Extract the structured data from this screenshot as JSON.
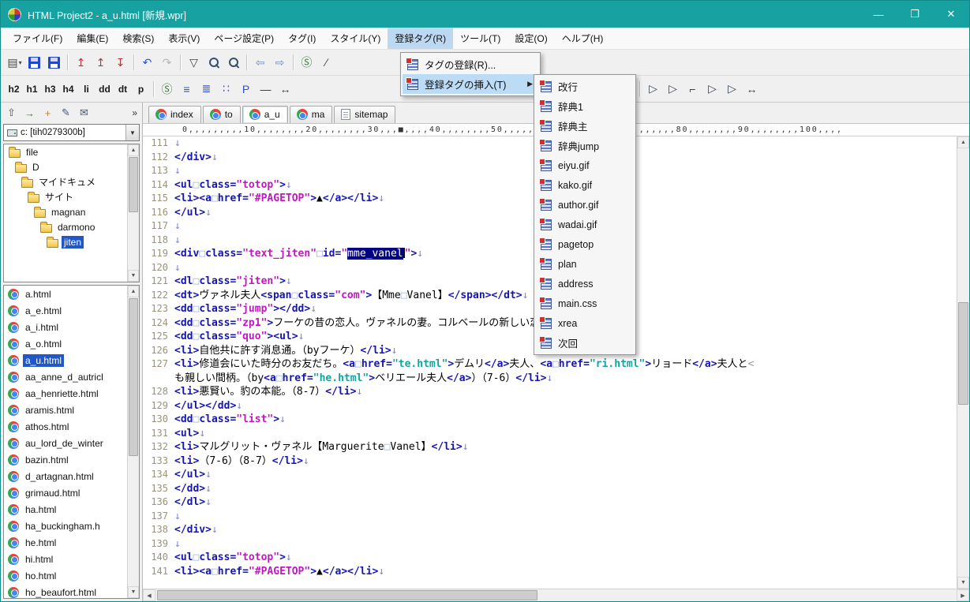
{
  "window": {
    "title": "HTML Project2 - a_u.html [新規.wpr]",
    "controls": {
      "minimize": "—",
      "maximize": "❐",
      "close": "✕"
    }
  },
  "menubar": {
    "items": [
      {
        "label": "ファイル(F)"
      },
      {
        "label": "編集(E)"
      },
      {
        "label": "検索(S)"
      },
      {
        "label": "表示(V)"
      },
      {
        "label": "ページ設定(P)"
      },
      {
        "label": "タグ(I)"
      },
      {
        "label": "スタイル(Y)"
      },
      {
        "label": "登録タグ(R)",
        "active": true
      },
      {
        "label": "ツール(T)"
      },
      {
        "label": "設定(O)"
      },
      {
        "label": "ヘルプ(H)"
      }
    ]
  },
  "toolbar_main": {
    "buttons": [
      {
        "n": "new-file-button",
        "g": "▤",
        "g2": "▾",
        "c": "#444"
      },
      {
        "n": "save-button",
        "cls": "icon-floppy"
      },
      {
        "n": "save-all-button",
        "cls": "icon-floppy"
      },
      {
        "sep": true
      },
      {
        "n": "upload-page-button",
        "g": "↥",
        "c": "#b03838"
      },
      {
        "n": "upload-all-button",
        "g": "↥",
        "c": "#b03838"
      },
      {
        "n": "download-page-button",
        "g": "↧",
        "c": "#b03838"
      },
      {
        "sep": true
      },
      {
        "n": "undo-button",
        "g": "↶",
        "c": "#2a55cc"
      },
      {
        "n": "redo-button",
        "g": "↷",
        "c": "#b5b5b5"
      },
      {
        "sep": true
      },
      {
        "n": "selection-button",
        "g": "▽",
        "c": "#334455"
      },
      {
        "n": "search-button",
        "cls": "icon-mag"
      },
      {
        "n": "search-next-button",
        "cls": "icon-mag"
      },
      {
        "sep": true
      },
      {
        "n": "back-button",
        "g": "⇦",
        "c": "#7788bb"
      },
      {
        "n": "forward-button",
        "g": "⇨",
        "c": "#7788bb"
      },
      {
        "sep": true
      },
      {
        "n": "browser-preview-button",
        "g": "Ⓢ",
        "c": "#3a7a3a"
      },
      {
        "n": "slash-check-button",
        "g": "∕",
        "c": "#334455"
      }
    ]
  },
  "toolbar_format": {
    "text_buttons": [
      {
        "n": "h2-button",
        "label": "h2"
      },
      {
        "n": "h1-button",
        "label": "h1"
      },
      {
        "n": "h3-button",
        "label": "h3"
      },
      {
        "n": "h4-button",
        "label": "h4"
      },
      {
        "n": "li-button",
        "label": "li"
      },
      {
        "n": "dd-button",
        "label": "dd"
      },
      {
        "n": "dt-button",
        "label": "dt"
      },
      {
        "n": "p-button",
        "label": "p"
      }
    ],
    "icons": [
      {
        "n": "style-button",
        "g": "Ⓢ",
        "c": "#3a7a3a"
      },
      {
        "n": "ul-list-button",
        "g": "≡",
        "c": "#2a55cc"
      },
      {
        "n": "ol-list-button",
        "g": "≣",
        "c": "#2a55cc"
      },
      {
        "n": "dl-list-button",
        "g": "∷",
        "c": "#2a55cc"
      },
      {
        "n": "paragraph-button",
        "g": "P",
        "c": "#2a55cc"
      },
      {
        "n": "hr-button",
        "g": "—",
        "c": "#333333"
      },
      {
        "n": "width-button",
        "g": "↔",
        "c": "#334455"
      }
    ],
    "tail_icons": [
      {
        "n": "colored-list-button",
        "g": "≣",
        "c": "#c05050"
      },
      {
        "n": "style-select-button",
        "g": "Ⓢ",
        "g2": "▾",
        "c": "#3a7a3a"
      },
      {
        "n": "strip-tag-button-1",
        "g": "S̸",
        "c": "#b04ab0"
      },
      {
        "n": "strip-tag-button-2",
        "g": "S̸",
        "c": "#b04ab0"
      },
      {
        "n": "strip-tag-button-3",
        "g": "S̸",
        "c": "#b04ab0"
      },
      {
        "n": "insert-tag-button-1",
        "g": "▷",
        "c": "#334455"
      },
      {
        "sep": true
      },
      {
        "n": "insert-tag-button-2",
        "g": "▷",
        "c": "#334455"
      },
      {
        "n": "insert-tag-button-3",
        "g": "▷",
        "c": "#334455"
      },
      {
        "n": "edge-marker-button",
        "g": "⌐",
        "c": "#334455"
      },
      {
        "n": "insert-tag-button-4",
        "g": "▷",
        "c": "#334455"
      },
      {
        "n": "insert-tag-button-5",
        "g": "▷",
        "c": "#334455"
      },
      {
        "n": "fullwidth-button",
        "g": "↔",
        "c": "#334455"
      }
    ]
  },
  "tag_menu": {
    "items": [
      {
        "label": "タグの登録(R)...",
        "active": false,
        "submenu": false
      },
      {
        "label": "登録タグの挿入(T)",
        "active": true,
        "submenu": true
      }
    ],
    "submenu_arrow": "▶"
  },
  "tag_submenu": {
    "items": [
      "改行",
      "辞典1",
      "辞典主",
      "辞典jump",
      "eiyu.gif",
      "kako.gif",
      "author.gif",
      "wadai.gif",
      "pagetop",
      "plan",
      "address",
      "main.css",
      "xrea",
      "次回"
    ]
  },
  "sidebar": {
    "mini_toolbar": [
      {
        "n": "parent-folder-button",
        "g": "⇧",
        "c": "#445577"
      },
      {
        "n": "go-button",
        "g": "→",
        "c": "#2a8a2a"
      },
      {
        "n": "new-folder-button",
        "g": "+",
        "c": "#b08a2a"
      },
      {
        "n": "edit-button",
        "g": "✎",
        "c": "#445577"
      },
      {
        "n": "mail-button",
        "g": "✉",
        "c": "#445577"
      }
    ],
    "overflow_chevron": "»",
    "drive_select": {
      "value": "c: [tih0279300b]",
      "arrow": "▼"
    },
    "tree": [
      {
        "label": "file",
        "level": 0
      },
      {
        "label": "D",
        "level": 1
      },
      {
        "label": "マイドキュメ",
        "level": 2
      },
      {
        "label": "サイト",
        "level": 3
      },
      {
        "label": "magnan",
        "level": 4
      },
      {
        "label": "darmono",
        "level": 5
      },
      {
        "label": "jiten",
        "level": 6,
        "selected": true
      }
    ],
    "files": [
      {
        "name": "a.html"
      },
      {
        "name": "a_e.html"
      },
      {
        "name": "a_i.html"
      },
      {
        "name": "a_o.html"
      },
      {
        "name": "a_u.html",
        "selected": true
      },
      {
        "name": "aa_anne_d_autricl"
      },
      {
        "name": "aa_henriette.html"
      },
      {
        "name": "aramis.html"
      },
      {
        "name": "athos.html"
      },
      {
        "name": "au_lord_de_winter"
      },
      {
        "name": "bazin.html"
      },
      {
        "name": "d_artagnan.html"
      },
      {
        "name": "grimaud.html"
      },
      {
        "name": "ha.html"
      },
      {
        "name": "ha_buckingham.h"
      },
      {
        "name": "he.html"
      },
      {
        "name": "hi.html"
      },
      {
        "name": "ho.html"
      },
      {
        "name": "ho_beaufort.html"
      }
    ]
  },
  "tabs": [
    {
      "label": "index",
      "icon": "chrome"
    },
    {
      "label": "to",
      "icon": "chrome"
    },
    {
      "label": "a_u",
      "icon": "chrome",
      "active": true
    },
    {
      "label": "ma",
      "icon": "chrome"
    },
    {
      "label": "sitemap",
      "icon": "page"
    }
  ],
  "editor": {
    "ruler": "0,,,,,,,,,10,,,,,,,,20,,,,,,,,30,,,■,,,,40,,,,,,,,50,,,,,,,,60,,,,,,,,70,,,,,,,,80,,,,,,,,90,,,,,,,,100,,,,",
    "scroll_arrows": {
      "up": "▲",
      "down": "▼",
      "left": "◀",
      "right": "▶"
    },
    "lines": [
      {
        "n": "111",
        "s": [
          [
            "nl",
            "↓"
          ]
        ]
      },
      {
        "n": "112",
        "s": [
          [
            "tg",
            "</div>"
          ],
          [
            "nl",
            "↓"
          ]
        ]
      },
      {
        "n": "113",
        "s": [
          [
            "nl",
            "↓"
          ]
        ]
      },
      {
        "n": "114",
        "s": [
          [
            "tg",
            "<ul"
          ],
          [
            "fs",
            "□"
          ],
          [
            "tg",
            "class="
          ],
          [
            "vl",
            "\"totop\""
          ],
          [
            "tg",
            ">"
          ],
          [
            "nl",
            "↓"
          ]
        ]
      },
      {
        "n": "115",
        "s": [
          [
            "tg",
            "<li><a"
          ],
          [
            "fs",
            "□"
          ],
          [
            "tg",
            "href="
          ],
          [
            "vl",
            "\"#PAGETOP\""
          ],
          [
            "tg",
            ">"
          ],
          [
            "tx",
            "▲"
          ],
          [
            "tg",
            "</a></li>"
          ],
          [
            "nl",
            "↓"
          ]
        ]
      },
      {
        "n": "116",
        "s": [
          [
            "tg",
            "</ul>"
          ],
          [
            "nl",
            "↓"
          ]
        ]
      },
      {
        "n": "117",
        "s": [
          [
            "nl",
            "↓"
          ]
        ]
      },
      {
        "n": "118",
        "s": [
          [
            "nl",
            "↓"
          ]
        ]
      },
      {
        "n": "119",
        "s": [
          [
            "tg",
            "<div"
          ],
          [
            "fs",
            "□"
          ],
          [
            "tg",
            "class="
          ],
          [
            "vl",
            "\"text_jiten\""
          ],
          [
            "fs",
            "□"
          ],
          [
            "tg",
            "id="
          ],
          [
            "vl",
            "\""
          ],
          [
            "sel",
            "mme_vanel"
          ],
          [
            "cur",
            ""
          ],
          [
            "vl",
            "\""
          ],
          [
            "tg",
            ">"
          ],
          [
            "nl",
            "↓"
          ]
        ]
      },
      {
        "n": "120",
        "s": [
          [
            "nl",
            "↓"
          ]
        ]
      },
      {
        "n": "121",
        "s": [
          [
            "tg",
            "<dl"
          ],
          [
            "fs",
            "□"
          ],
          [
            "tg",
            "class="
          ],
          [
            "vl",
            "\"jiten\""
          ],
          [
            "tg",
            ">"
          ],
          [
            "nl",
            "↓"
          ]
        ]
      },
      {
        "n": "122",
        "s": [
          [
            "tg",
            "<dt>"
          ],
          [
            "tx",
            "ヴァネル夫人"
          ],
          [
            "tg",
            "<span"
          ],
          [
            "fs",
            "□"
          ],
          [
            "tg",
            "class="
          ],
          [
            "vl",
            "\"com\""
          ],
          [
            "tg",
            ">"
          ],
          [
            "tx",
            "【Mme"
          ],
          [
            "fs",
            "□"
          ],
          [
            "tx",
            "Vanel】"
          ],
          [
            "tg",
            "</span></dt>"
          ],
          [
            "nl",
            "↓"
          ]
        ]
      },
      {
        "n": "123",
        "s": [
          [
            "tg",
            "<dd"
          ],
          [
            "fs",
            "□"
          ],
          [
            "tg",
            "class="
          ],
          [
            "vl",
            "\"jump\""
          ],
          [
            "tg",
            "></dd>"
          ],
          [
            "nl",
            "↓"
          ]
        ]
      },
      {
        "n": "124",
        "s": [
          [
            "tg",
            "<dd"
          ],
          [
            "fs",
            "□"
          ],
          [
            "tg",
            "class="
          ],
          [
            "vl",
            "\"zp1\""
          ],
          [
            "tg",
            ">"
          ],
          [
            "tx",
            "フーケの昔の恋人。ヴァネルの妻。コルベールの新しい恋人"
          ],
          [
            "tg",
            "</dd>"
          ],
          [
            "nl",
            "↓"
          ]
        ]
      },
      {
        "n": "125",
        "s": [
          [
            "tg",
            "<dd"
          ],
          [
            "fs",
            "□"
          ],
          [
            "tg",
            "class="
          ],
          [
            "vl",
            "\"quo\""
          ],
          [
            "tg",
            "><ul>"
          ],
          [
            "nl",
            "↓"
          ]
        ]
      },
      {
        "n": "126",
        "s": [
          [
            "tg",
            "<li>"
          ],
          [
            "tx",
            "自他共に許す消息通。（byフーケ）"
          ],
          [
            "tg",
            "</li>"
          ],
          [
            "nl",
            "↓"
          ]
        ]
      },
      {
        "n": "127",
        "s": [
          [
            "tg",
            "<li>"
          ],
          [
            "tx",
            "修道会にいた時分のお友だち。"
          ],
          [
            "tg",
            "<a"
          ],
          [
            "fs",
            "□"
          ],
          [
            "tg",
            "href="
          ],
          [
            "lk",
            "\"te.html\""
          ],
          [
            "tg",
            ">"
          ],
          [
            "tx",
            "デムリ"
          ],
          [
            "tg",
            "</a>"
          ],
          [
            "tx",
            "夫人、"
          ],
          [
            "tg",
            "<a"
          ],
          [
            "fs",
            "□"
          ],
          [
            "tg",
            "href="
          ],
          [
            "lk",
            "\"ri.html\""
          ],
          [
            "tg",
            ">"
          ],
          [
            "tx",
            "リョード"
          ],
          [
            "tg",
            "</a>"
          ],
          [
            "tx",
            "夫人と"
          ],
          [
            "wr",
            "<"
          ]
        ]
      },
      {
        "n": "",
        "s": [
          [
            "tx",
            "も親しい間柄。（by"
          ],
          [
            "tg",
            "<a"
          ],
          [
            "fs",
            "□"
          ],
          [
            "tg",
            "href="
          ],
          [
            "lk",
            "\"he.html\""
          ],
          [
            "tg",
            ">"
          ],
          [
            "tx",
            "ベリエール夫人"
          ],
          [
            "tg",
            "</a>"
          ],
          [
            "tx",
            "）（7-6）"
          ],
          [
            "tg",
            "</li>"
          ],
          [
            "nl",
            "↓"
          ]
        ]
      },
      {
        "n": "128",
        "s": [
          [
            "tg",
            "<li>"
          ],
          [
            "tx",
            "悪賢い。豹の本能。（8-7）"
          ],
          [
            "tg",
            "</li>"
          ],
          [
            "nl",
            "↓"
          ]
        ]
      },
      {
        "n": "129",
        "s": [
          [
            "tg",
            "</ul></dd>"
          ],
          [
            "nl",
            "↓"
          ]
        ]
      },
      {
        "n": "130",
        "s": [
          [
            "tg",
            "<dd"
          ],
          [
            "fs",
            "□"
          ],
          [
            "tg",
            "class="
          ],
          [
            "vl",
            "\"list\""
          ],
          [
            "tg",
            ">"
          ],
          [
            "nl",
            "↓"
          ]
        ]
      },
      {
        "n": "131",
        "s": [
          [
            "tg",
            "<ul>"
          ],
          [
            "nl",
            "↓"
          ]
        ]
      },
      {
        "n": "132",
        "s": [
          [
            "tg",
            "<li>"
          ],
          [
            "tx",
            "マルグリット・ヴァネル【Marguerite"
          ],
          [
            "fs",
            "□"
          ],
          [
            "tx",
            "Vanel】"
          ],
          [
            "tg",
            "</li>"
          ],
          [
            "nl",
            "↓"
          ]
        ]
      },
      {
        "n": "133",
        "s": [
          [
            "tg",
            "<li>"
          ],
          [
            "tx",
            "（7-6）（8-7）"
          ],
          [
            "tg",
            "</li>"
          ],
          [
            "nl",
            "↓"
          ]
        ]
      },
      {
        "n": "134",
        "s": [
          [
            "tg",
            "</ul>"
          ],
          [
            "nl",
            "↓"
          ]
        ]
      },
      {
        "n": "135",
        "s": [
          [
            "tg",
            "</dd>"
          ],
          [
            "nl",
            "↓"
          ]
        ]
      },
      {
        "n": "136",
        "s": [
          [
            "tg",
            "</dl>"
          ],
          [
            "nl",
            "↓"
          ]
        ]
      },
      {
        "n": "137",
        "s": [
          [
            "nl",
            "↓"
          ]
        ]
      },
      {
        "n": "138",
        "s": [
          [
            "tg",
            "</div>"
          ],
          [
            "nl",
            "↓"
          ]
        ]
      },
      {
        "n": "139",
        "s": [
          [
            "nl",
            "↓"
          ]
        ]
      },
      {
        "n": "140",
        "s": [
          [
            "tg",
            "<ul"
          ],
          [
            "fs",
            "□"
          ],
          [
            "tg",
            "class="
          ],
          [
            "vl",
            "\"totop\""
          ],
          [
            "tg",
            ">"
          ],
          [
            "nl",
            "↓"
          ]
        ]
      },
      {
        "n": "141",
        "s": [
          [
            "tg",
            "<li><a"
          ],
          [
            "fs",
            "□"
          ],
          [
            "tg",
            "href="
          ],
          [
            "vl",
            "\"#PAGETOP\""
          ],
          [
            "tg",
            ">"
          ],
          [
            "tx",
            "▲"
          ],
          [
            "tg",
            "</a></li>"
          ],
          [
            "nl",
            "↓"
          ]
        ]
      }
    ]
  }
}
